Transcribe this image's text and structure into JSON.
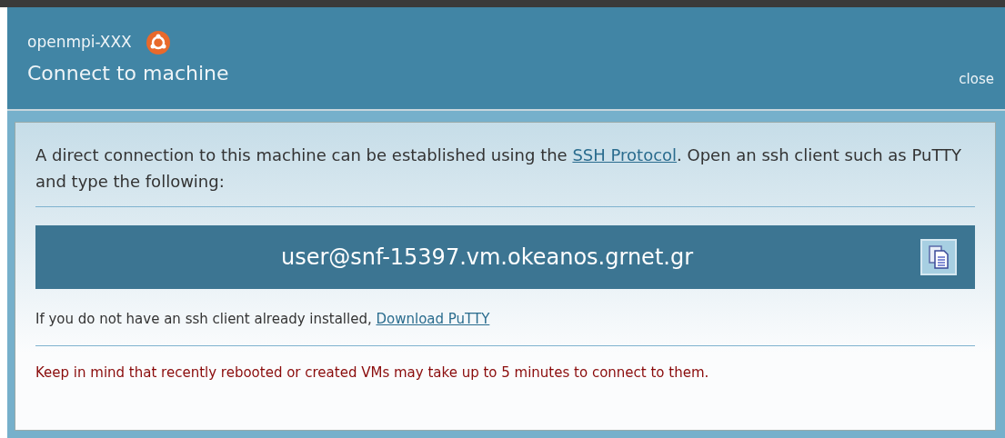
{
  "header": {
    "machine_name": "openmpi-XXX",
    "title": "Connect to machine",
    "close": "close"
  },
  "intro": {
    "before": "A direct connection to this machine can be established using the ",
    "link": "SSH Protocol",
    "after": ". Open an ssh client such as PuTTY and type the following:"
  },
  "command": "user@snf-15397.vm.okeanos.grnet.gr",
  "download": {
    "text": "If you do not have an ssh client already installed, ",
    "link": "Download PuTTY"
  },
  "warning": "Keep in mind that recently rebooted or created VMs may take up to 5 minutes to connect to them."
}
